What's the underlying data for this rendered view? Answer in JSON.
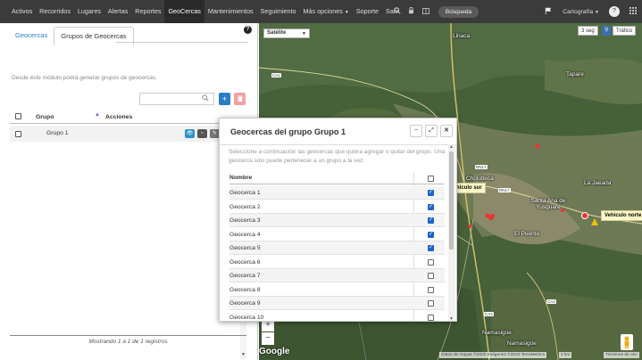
{
  "nav": {
    "items": [
      "Activos",
      "Recorridos",
      "Lugares",
      "Alertas",
      "Reportes",
      "GeoCercas",
      "Mantenimientos",
      "Seguimiento",
      "Más opciones",
      "Soporte",
      "Salir"
    ],
    "active": "GeoCercas",
    "search_label": "Búsqueda",
    "cartography_label": "Cartografía",
    "icons": [
      "search-icon",
      "lock-icon",
      "window-icon",
      "flag-icon",
      "help-icon",
      "grid-icon"
    ]
  },
  "left": {
    "tab_geocercas": "Geocercas",
    "tab_grupos": "Grupos de Geocercas",
    "description": "Desde éste módulo podrá generar grupos de geocercas.",
    "col_group": "Grupo",
    "col_actions": "Acciones",
    "rows": [
      {
        "name": "Grupo 1"
      }
    ],
    "footer": "Mostrando 1 a 1 de 1 registros"
  },
  "map": {
    "map_type": "Satélite",
    "refresh": "3 seg",
    "traffic": "Tráfico",
    "places": [
      "Linaca",
      "Tapare",
      "Cholutleca",
      "La Jaeada",
      "Santa Ana de Yusguare",
      "El Puente",
      "Namasigüe",
      "Namasigüe"
    ],
    "roads": [
      "CA1",
      "RN17",
      "RN17",
      "CA3",
      "CA3"
    ],
    "vehicle_left": "Vehiculo sur",
    "vehicle_right": "Vehiculo norte",
    "attribution": "Datos de mapas ©2020 Imágenes ©2020 TerraMetrics",
    "scale": "2 km",
    "terms": "Términos de uso",
    "zoom_in": "+",
    "zoom_out": "−",
    "google": "Google"
  },
  "modal": {
    "title": "Geocercas del grupo Grupo 1",
    "description": "Seleccione a continuación las geocercas que quiera agregar o quitar del grupo. Una geocerca sólo puede pertenecer a un grupo a la vez.",
    "col_name": "Nombre",
    "geocercas": [
      {
        "name": "Geocerca 1",
        "checked": true
      },
      {
        "name": "Geocerca 2",
        "checked": true
      },
      {
        "name": "Geocerca 3",
        "checked": true
      },
      {
        "name": "Geocerca 4",
        "checked": true
      },
      {
        "name": "Geocerca 5",
        "checked": true
      },
      {
        "name": "Geocerca 6",
        "checked": false
      },
      {
        "name": "Geocerca 7",
        "checked": false
      },
      {
        "name": "Geocerca 8",
        "checked": false
      },
      {
        "name": "Geocerca 9",
        "checked": false
      },
      {
        "name": "Geocerca 10",
        "checked": false
      }
    ]
  }
}
